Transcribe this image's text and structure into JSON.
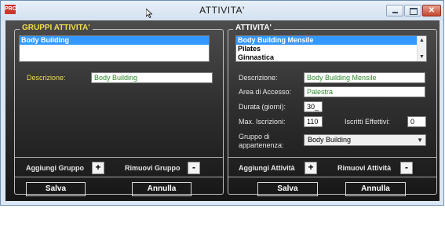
{
  "window": {
    "title": "ATTIVITA'",
    "app_icon_text": "PRO"
  },
  "left": {
    "legend": "GRUPPI ATTIVITA'",
    "list": [
      "Body Building"
    ],
    "desc_label": "Descrizione:",
    "desc_value": "Body Building",
    "add_label": "Aggiungi Gruppo",
    "add_symbol": "+",
    "remove_label": "Rimuovi Gruppo",
    "remove_symbol": "-",
    "save": "Salva",
    "cancel": "Annulla"
  },
  "right": {
    "legend": "ATTIVITA'",
    "list": [
      "Body Building Mensile",
      "Pilates",
      "Ginnastica"
    ],
    "desc_label": "Descrizione:",
    "desc_value": "Body Building Mensile",
    "area_label": "Area di Accesso:",
    "area_value": "Palestra",
    "duration_label": "Durata (giorni):",
    "duration_value": "30_",
    "max_label": "Max. Iscrizioni:",
    "max_value": "110",
    "effective_label": "Iscritti Effettivi:",
    "effective_value": "0",
    "group_label_1": "Gruppo di",
    "group_label_2": "appartenenza:",
    "group_value": "Body Building",
    "add_label": "Aggiungi Attività",
    "add_symbol": "+",
    "remove_label": "Rimuovi Attività",
    "remove_symbol": "-",
    "save": "Salva",
    "cancel": "Annulla"
  }
}
